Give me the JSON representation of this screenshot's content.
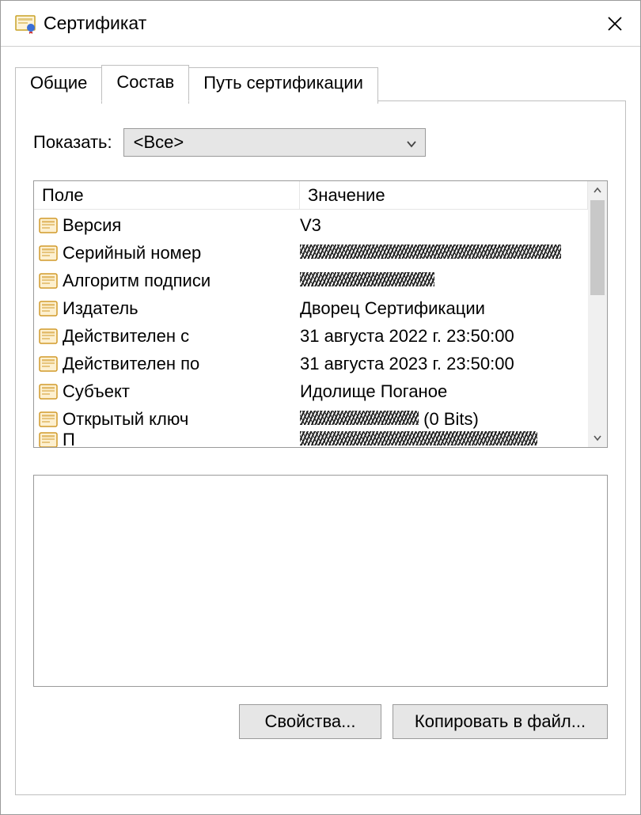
{
  "window": {
    "title": "Сертификат"
  },
  "tabs": {
    "general": "Общие",
    "details": "Состав",
    "certpath": "Путь сертификации"
  },
  "show": {
    "label": "Показать:",
    "selected": "<Все>"
  },
  "columns": {
    "field": "Поле",
    "value": "Значение"
  },
  "rows": [
    {
      "field": "Версия",
      "value": "V3",
      "redacted": false
    },
    {
      "field": "Серийный номер",
      "value": "",
      "redacted": true,
      "redactWidth": 330
    },
    {
      "field": "Алгоритм подписи",
      "value": "",
      "redacted": true,
      "redactWidth": 170
    },
    {
      "field": "Издатель",
      "value": "Дворец Сертификации",
      "redacted": false
    },
    {
      "field": "Действителен с",
      "value": "31 августа 2022 г. 23:50:00",
      "redacted": false
    },
    {
      "field": "Действителен по",
      "value": "31 августа 2023 г. 23:50:00",
      "redacted": false
    },
    {
      "field": "Субъект",
      "value": "Идолище Поганое",
      "redacted": false
    },
    {
      "field": "Открытый ключ",
      "value": " (0 Bits)",
      "redacted": true,
      "redactWidth": 150,
      "suffix": " (0 Bits)"
    },
    {
      "field": "П",
      "value": "",
      "redacted": true,
      "redactWidth": 300,
      "partial": true
    }
  ],
  "buttons": {
    "properties": "Свойства...",
    "copyToFile": "Копировать в файл..."
  }
}
